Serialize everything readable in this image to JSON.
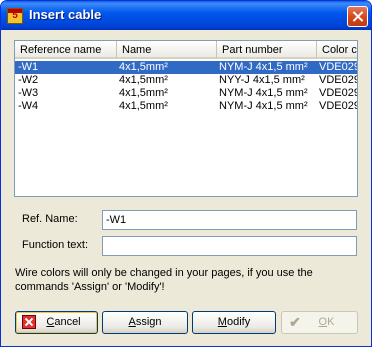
{
  "window": {
    "title": "Insert cable",
    "app_icon_glyph": "5"
  },
  "table": {
    "columns": [
      "Reference name",
      "Name",
      "Part number",
      "Color c"
    ],
    "rows": [
      {
        "ref": "-W1",
        "name": "4x1,5mm²",
        "part": "NYM-J 4x1,5 mm²",
        "color": "VDE029",
        "selected": true
      },
      {
        "ref": "-W2",
        "name": "4x1,5mm²",
        "part": "NYY-J 4x1,5 mm²",
        "color": "VDE029",
        "selected": false
      },
      {
        "ref": "-W3",
        "name": "4x1,5mm²",
        "part": "NYM-J 4x1,5 mm²",
        "color": "VDE029",
        "selected": false
      },
      {
        "ref": "-W4",
        "name": "4x1,5mm²",
        "part": "NYM-J 4x1,5 mm²",
        "color": "VDE029",
        "selected": false
      }
    ]
  },
  "form": {
    "ref_name_label": "Ref. Name:",
    "ref_name_value": "-W1",
    "function_text_label": "Function text:",
    "function_text_value": ""
  },
  "note": "Wire colors will only be changed in your pages, if you use the commands 'Assign' or 'Modify'!",
  "buttons": {
    "cancel": {
      "label_pre": "",
      "label_key": "C",
      "label_post": "ancel"
    },
    "assign": {
      "label_pre": "",
      "label_key": "A",
      "label_post": "ssign"
    },
    "modify": {
      "label_pre": "",
      "label_key": "M",
      "label_post": "odify"
    },
    "ok": {
      "label_pre": "",
      "label_key": "O",
      "label_post": "K"
    }
  },
  "icons": {
    "close": "close-icon",
    "cancel": "cancel-icon",
    "ok": "checkmark-icon",
    "scroll_left": "◀",
    "scroll_right": "▶"
  }
}
